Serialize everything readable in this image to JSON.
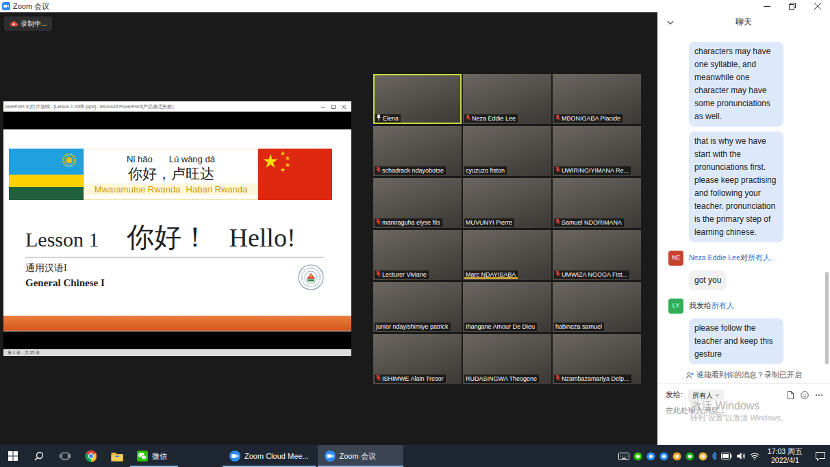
{
  "window": {
    "title": "Zoom 会议"
  },
  "recording": {
    "label": "录制中..."
  },
  "shared_screen": {
    "window_title": "owerPoint 幻灯片放映 - [Lesson 1 G5班.pptx] - Microsoft PowerPoint(产品激活失败)",
    "slide": {
      "pinyin": [
        "Nǐ hǎo",
        "Lú wàng dá"
      ],
      "greeting": "你好，卢旺达",
      "subtitles": [
        "Mwaramutse Rwanda",
        "Habari Rwanda"
      ],
      "lesson": "Lesson 1",
      "title_zh": "你好！",
      "title_en": "Hello!",
      "course_zh": "通用汉语I",
      "course_en": "General Chinese I"
    },
    "status": "第 1 张，共 23 张"
  },
  "participants": [
    {
      "name": "Elena",
      "pinned": true,
      "highlighted": true,
      "muted": false,
      "speaking": false
    },
    {
      "name": "Neza Eddie Lee",
      "pinned": false,
      "highlighted": false,
      "muted": true,
      "speaking": false
    },
    {
      "name": "MBONIGABA Placide",
      "pinned": false,
      "highlighted": false,
      "muted": true,
      "speaking": false
    },
    {
      "name": "schadrack ndayobotse",
      "pinned": false,
      "highlighted": false,
      "muted": true,
      "speaking": false
    },
    {
      "name": "cyuzuzo fiston",
      "pinned": false,
      "highlighted": false,
      "muted": false,
      "speaking": false
    },
    {
      "name": "UWIRINGIYIMANA Re...",
      "pinned": false,
      "highlighted": false,
      "muted": true,
      "speaking": false
    },
    {
      "name": "maniraguha elyse fils",
      "pinned": false,
      "highlighted": false,
      "muted": true,
      "speaking": false
    },
    {
      "name": "MUVUNYI Pierre",
      "pinned": false,
      "highlighted": false,
      "muted": false,
      "speaking": false
    },
    {
      "name": "Samuel NDORIMANA",
      "pinned": false,
      "highlighted": false,
      "muted": true,
      "speaking": false
    },
    {
      "name": "Lecturer Viviane",
      "pinned": false,
      "highlighted": false,
      "muted": true,
      "speaking": false
    },
    {
      "name": "Marc NDAYISABA",
      "pinned": false,
      "highlighted": false,
      "muted": false,
      "speaking": true
    },
    {
      "name": "UMWIZA NGOGA Fist...",
      "pinned": false,
      "highlighted": false,
      "muted": true,
      "speaking": false
    },
    {
      "name": "junior ndayishimiye patrick",
      "pinned": false,
      "highlighted": false,
      "muted": false,
      "speaking": false
    },
    {
      "name": "Ihangane Amour De Dieu",
      "pinned": false,
      "highlighted": false,
      "muted": false,
      "speaking": false
    },
    {
      "name": "habineza samuel",
      "pinned": false,
      "highlighted": false,
      "muted": false,
      "speaking": false
    },
    {
      "name": "ISHIMWE Alain Tresor",
      "pinned": false,
      "highlighted": false,
      "muted": true,
      "speaking": false
    },
    {
      "name": "RUDASINGWA Theogene",
      "pinned": false,
      "highlighted": false,
      "muted": false,
      "speaking": false
    },
    {
      "name": "Nzambazamariya Delp...",
      "pinned": false,
      "highlighted": false,
      "muted": true,
      "speaking": false
    }
  ],
  "chat": {
    "title": "聊天",
    "groups": [
      {
        "kind": "continued",
        "self": true,
        "bubbles": [
          "characters may have one syllable, and meanwhile one character may have some pronunciations as well.",
          "that is why we have start with the pronunciations first. please keep practising and following your teacher. pronunciation is the primary step of learning chinese."
        ]
      },
      {
        "kind": "headed",
        "self": false,
        "avatar": "NE",
        "color": "#c8432f",
        "sender": "Neza Eddie Lee",
        "connector": "对",
        "recipient": "所有人",
        "bubbles": [
          "got you"
        ]
      },
      {
        "kind": "headed",
        "self": true,
        "avatar": "LY",
        "color": "#2fae57",
        "sender": "我",
        "connector": "发给",
        "recipient": "所有人",
        "bubbles": [
          "please follow the teacher and keep this gesture"
        ]
      }
    ],
    "scroll_level": 1,
    "notice": "谁能看到你的消息？录制已开启",
    "send_to_label": "发给:",
    "recipient": "所有人",
    "placeholder": "在此处输入消息..."
  },
  "watermark": {
    "title": "激活 Windows",
    "hint": "转到“设置”以激活 Windows。"
  },
  "taskbar": {
    "apps": [
      {
        "label": "微信",
        "kind": "wechat",
        "running": true,
        "selected": false
      },
      {
        "label": "Zoom Cloud Mee...",
        "kind": "zoom",
        "running": true,
        "selected": false
      },
      {
        "label": "Zoom 会议",
        "kind": "zoom",
        "running": true,
        "selected": true
      }
    ],
    "time": "17:03 周五",
    "date": "2022/4/1"
  }
}
